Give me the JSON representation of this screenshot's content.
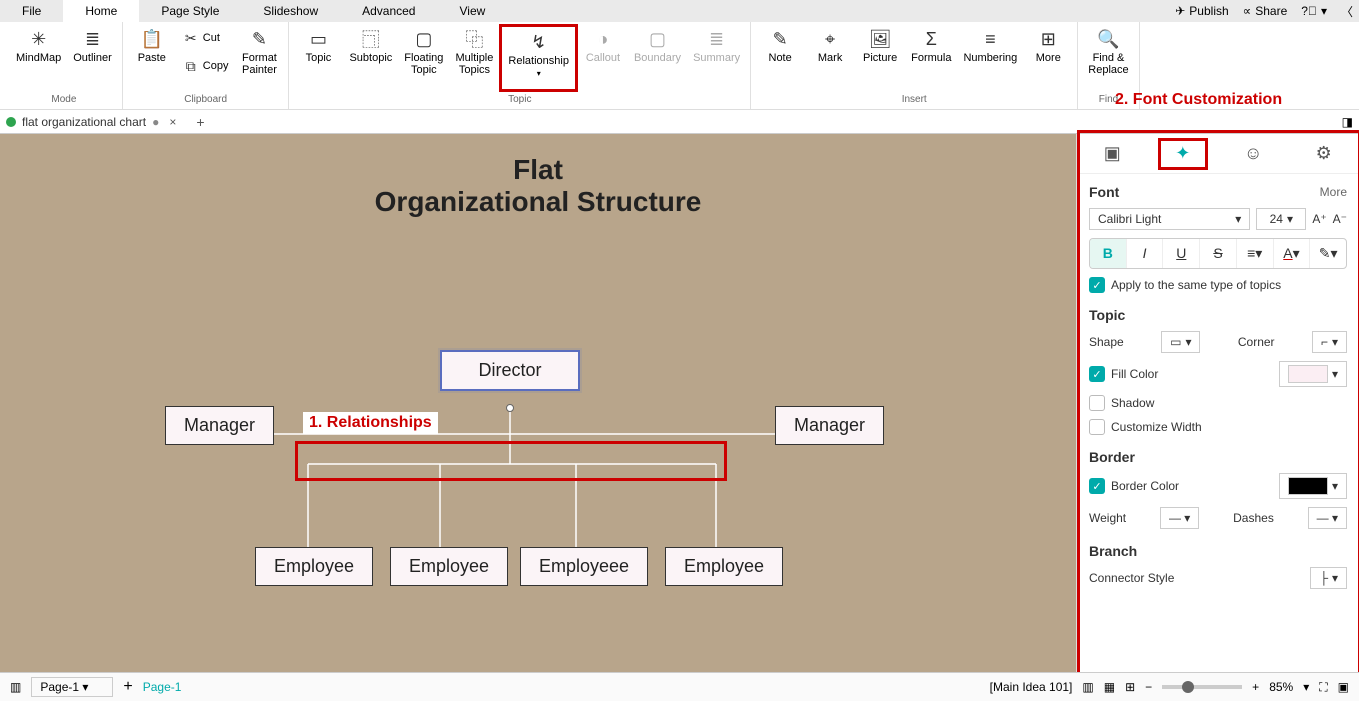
{
  "menu": {
    "file": "File",
    "home": "Home",
    "page_style": "Page Style",
    "slideshow": "Slideshow",
    "advanced": "Advanced",
    "view": "View",
    "publish": "Publish",
    "share": "Share"
  },
  "ribbon": {
    "mode": {
      "label": "Mode",
      "mindmap": "MindMap",
      "outliner": "Outliner"
    },
    "clipboard": {
      "label": "Clipboard",
      "paste": "Paste",
      "cut": "Cut",
      "copy": "Copy",
      "format_painter": "Format\nPainter"
    },
    "topic_group": {
      "label": "Topic",
      "topic": "Topic",
      "subtopic": "Subtopic",
      "floating": "Floating\nTopic",
      "multiple": "Multiple\nTopics",
      "relationship": "Relationship",
      "callout": "Callout",
      "boundary": "Boundary",
      "summary": "Summary"
    },
    "insert_group": {
      "label": "Insert",
      "note": "Note",
      "mark": "Mark",
      "picture": "Picture",
      "formula": "Formula",
      "numbering": "Numbering",
      "more": "More"
    },
    "find_group": {
      "label": "Find",
      "find_replace": "Find &\nReplace"
    }
  },
  "annotations": {
    "a1": "1. Relationships",
    "a2": "2. Font Customization"
  },
  "tab": {
    "name": "flat organizational chart"
  },
  "canvas": {
    "title_l1": "Flat",
    "title_l2": "Organizational Structure",
    "director": "Director",
    "manager": "Manager",
    "employee": "Employee",
    "employeee": "Employeee"
  },
  "panel": {
    "font": {
      "head": "Font",
      "more": "More",
      "family": "Calibri Light",
      "size": "24",
      "apply_same": "Apply to the same type of topics"
    },
    "topic": {
      "head": "Topic",
      "shape": "Shape",
      "corner": "Corner",
      "fill_color": "Fill Color",
      "shadow": "Shadow",
      "customize_width": "Customize Width"
    },
    "border": {
      "head": "Border",
      "border_color": "Border Color",
      "weight": "Weight",
      "dashes": "Dashes"
    },
    "branch": {
      "head": "Branch",
      "connector": "Connector Style"
    }
  },
  "status": {
    "page_dropdown": "Page-1",
    "page_tab": "Page-1",
    "main_idea": "[Main Idea 101]",
    "zoom": "85%"
  }
}
